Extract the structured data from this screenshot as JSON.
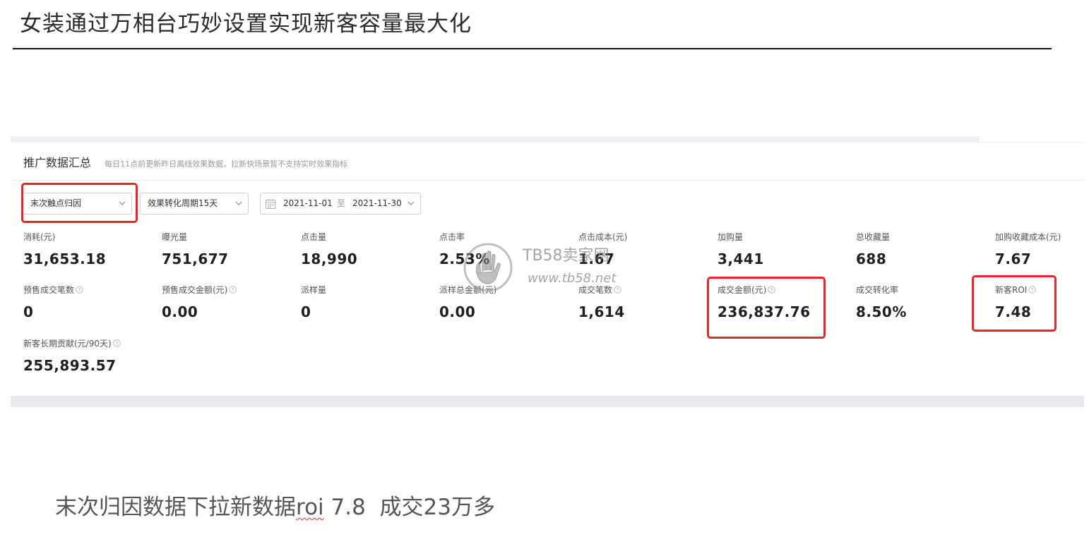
{
  "slide": {
    "title": "女装通过万相台巧妙设置实现新客容量最大化",
    "caption_before": "末次归因数据下拉新数据",
    "caption_marked": "roi",
    "caption_after": " 7.8  成交23万多"
  },
  "panel": {
    "title": "推广数据汇总",
    "subtitle": "每日11点前更新昨日离线效果数据，拉新快场景暂不支持实时效果指标"
  },
  "filters": {
    "attribution": "末次触点归因",
    "conversion_period": "效果转化周期15天",
    "date_start": "2021-11-01",
    "date_separator": "至",
    "date_end": "2021-11-30"
  },
  "metrics_row1": [
    {
      "label": "消耗(元)",
      "value": "31,653.18"
    },
    {
      "label": "曝光量",
      "value": "751,677"
    },
    {
      "label": "点击量",
      "value": "18,990"
    },
    {
      "label": "点击率",
      "value": "2.53%"
    },
    {
      "label": "点击成本(元)",
      "value": "1.67"
    },
    {
      "label": "加购量",
      "value": "3,441"
    },
    {
      "label": "总收藏量",
      "value": "688"
    },
    {
      "label": "加购收藏成本(元)",
      "value": "7.67"
    }
  ],
  "metrics_row2": [
    {
      "label": "预售成交笔数",
      "value": "0"
    },
    {
      "label": "预售成交金额(元)",
      "value": "0.00"
    },
    {
      "label": "派样量",
      "value": "0"
    },
    {
      "label": "派样总金额(元)",
      "value": "0.00"
    },
    {
      "label": "成交笔数",
      "value": "1,614"
    },
    {
      "label": "成交金额(元)",
      "value": "236,837.76"
    },
    {
      "label": "成交转化率",
      "value": "8.50%"
    },
    {
      "label": "新客ROI",
      "value": "7.48"
    }
  ],
  "metrics_row3": [
    {
      "label": "新客长期贡献(元/90天)",
      "value": "255,893.57"
    }
  ],
  "watermark": {
    "name": "TB58卖家网",
    "url": "www.tb58.net"
  },
  "colors": {
    "highlight": "#e8262a",
    "band": "#eef0f6"
  },
  "icons": {
    "dropdown": "chevron-down-icon",
    "calendar": "calendar-icon",
    "help": "help-circle-icon"
  }
}
